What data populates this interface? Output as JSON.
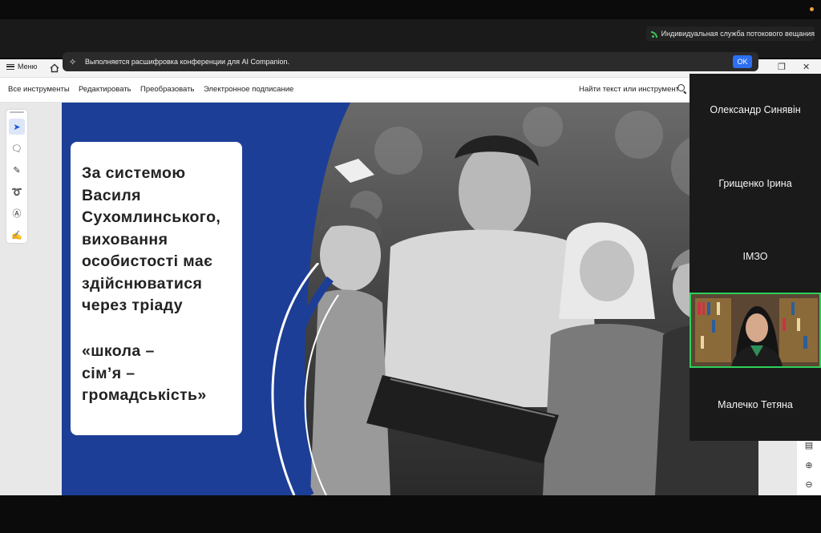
{
  "stream": {
    "label": "Индивидуальная служба потокового вещания"
  },
  "banner": {
    "message": "Выполняется расшифровка конференции для AI Companion.",
    "ok_label": "OK"
  },
  "app": {
    "menu_label": "Меню",
    "tabs": [
      "Все инструменты",
      "Редактировать",
      "Преобразовать",
      "Электронное подписание"
    ],
    "find_label": "Найти текст или инструмент"
  },
  "slide": {
    "paragraph": "За системою\nВасиля\nСухомлинського,\nвиховання\nособистості має\nздійснюватися\nчерез тріаду",
    "quote": "«школа –\nсім’я –\nгромадськість»"
  },
  "participants": [
    {
      "name": "Олександр Синявін"
    },
    {
      "name": "Грищенко Ірина"
    },
    {
      "name": "ІМЗО"
    },
    {
      "name": "Малечко Тетяна"
    }
  ],
  "colors": {
    "slide_blue": "#1c3e96",
    "ok_blue": "#2d6ff2",
    "active_speaker": "#2fd05a"
  }
}
